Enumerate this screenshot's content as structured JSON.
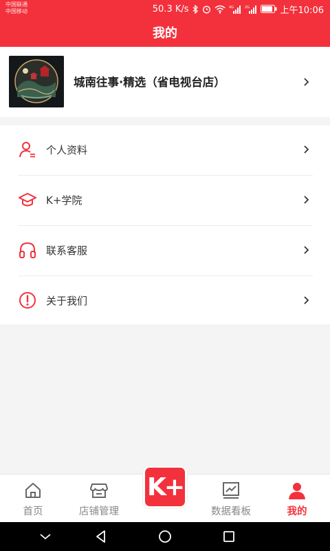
{
  "status_bar": {
    "carrier1": "中国联通",
    "carrier2": "中国移动",
    "speed": "50.3 K/s",
    "time": "上午10:06",
    "icons": [
      "bluetooth-icon",
      "alarm-icon",
      "wifi-icon",
      "signal-4g-icon",
      "signal-2g-icon",
      "battery-icon"
    ]
  },
  "header": {
    "title": "我的"
  },
  "store": {
    "name": "城南往事·精选（省电视台店）"
  },
  "menu": {
    "items": [
      {
        "label": "个人资料",
        "icon": "user-profile-icon"
      },
      {
        "label": "K+学院",
        "icon": "graduation-cap-icon"
      },
      {
        "label": "联系客服",
        "icon": "headphones-icon"
      },
      {
        "label": "关于我们",
        "icon": "info-icon"
      }
    ]
  },
  "tabbar": {
    "tabs": [
      {
        "label": "首页",
        "icon": "home-icon"
      },
      {
        "label": "店铺管理",
        "icon": "store-icon"
      },
      {
        "label": "K+",
        "icon": "k-plus-icon"
      },
      {
        "label": "数据看板",
        "icon": "chart-icon"
      },
      {
        "label": "我的",
        "icon": "person-icon"
      }
    ],
    "active": "我的"
  },
  "colors": {
    "accent": "#f3313c",
    "background": "#f4f4f4"
  }
}
